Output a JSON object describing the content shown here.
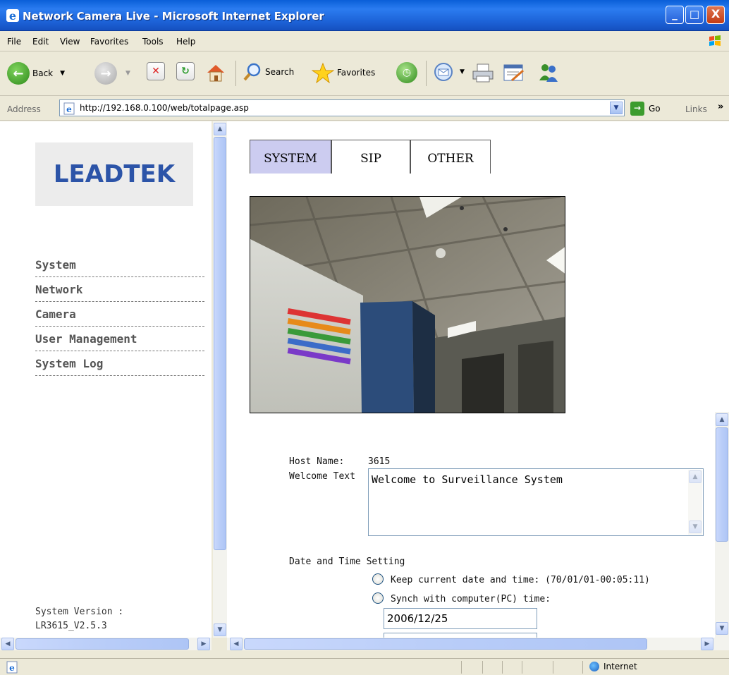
{
  "window": {
    "title": "Network Camera Live - Microsoft Internet Explorer",
    "min_glyph": "_",
    "max_glyph": "□",
    "close_glyph": "X"
  },
  "menu": [
    "File",
    "Edit",
    "View",
    "Favorites",
    "Tools",
    "Help"
  ],
  "toolbar": {
    "back_label": "Back",
    "search_label": "Search",
    "favorites_label": "Favorites"
  },
  "address": {
    "label": "Address",
    "url": "http://192.168.0.100/web/totalpage.asp",
    "go_label": "Go",
    "links_label": "Links",
    "chevron": "»"
  },
  "left": {
    "logo_text": "LEADTEK",
    "nav": [
      "System",
      "Network",
      "Camera",
      "User Management",
      "System Log"
    ],
    "version_label": "System Version :",
    "version_value": "LR3615_V2.5.3"
  },
  "tabs": [
    {
      "label": "SYSTEM",
      "active": true
    },
    {
      "label": "SIP",
      "active": false
    },
    {
      "label": "OTHER",
      "active": false
    }
  ],
  "form": {
    "host_label": "Host Name:",
    "host_value": "3615",
    "welcome_label": "Welcome Text",
    "welcome_value": "Welcome to Surveillance System",
    "datetime_heading": "Date and Time Setting",
    "keep_option": "Keep current date and time: (70/01/01-00:05:11)",
    "sync_option": "Synch with computer(PC) time:",
    "date_value": "2006/12/25"
  },
  "status": {
    "zone": "Internet"
  }
}
